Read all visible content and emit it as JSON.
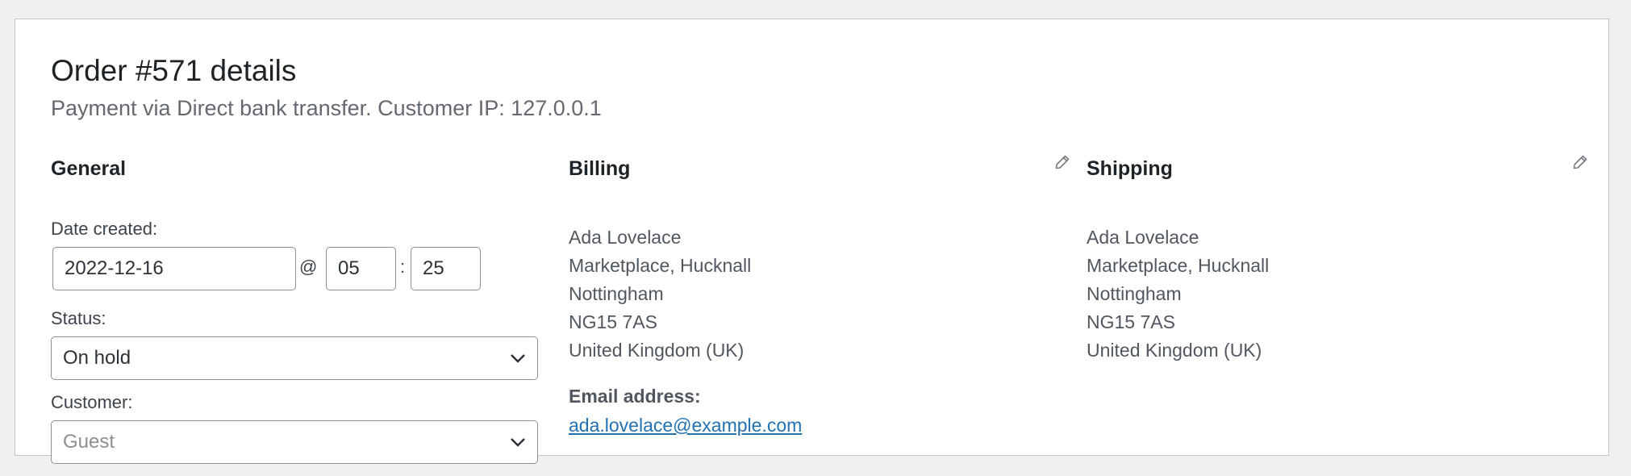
{
  "order": {
    "title": "Order #571 details",
    "subtitle": "Payment via Direct bank transfer. Customer IP: 127.0.0.1"
  },
  "general": {
    "heading": "General",
    "date_label": "Date created:",
    "date_value": "2022-12-16",
    "at_sign": "@",
    "hour_value": "05",
    "time_sep": ":",
    "minute_value": "25",
    "status_label": "Status:",
    "status_value": "On hold",
    "customer_label": "Customer:",
    "customer_value": "Guest"
  },
  "billing": {
    "heading": "Billing",
    "edit_icon": "pencil-icon",
    "address": {
      "name": "Ada Lovelace",
      "street": "Marketplace, Hucknall",
      "city": "Nottingham",
      "postcode": "NG15 7AS",
      "country": "United Kingdom (UK)"
    },
    "email_label": "Email address:",
    "email": "ada.lovelace@example.com"
  },
  "shipping": {
    "heading": "Shipping",
    "edit_icon": "pencil-icon",
    "address": {
      "name": "Ada Lovelace",
      "street": "Marketplace, Hucknall",
      "city": "Nottingham",
      "postcode": "NG15 7AS",
      "country": "United Kingdom (UK)"
    }
  },
  "colors": {
    "link": "#2271b1",
    "text": "#1d2327",
    "muted": "#646970",
    "border": "#8c8f94"
  }
}
